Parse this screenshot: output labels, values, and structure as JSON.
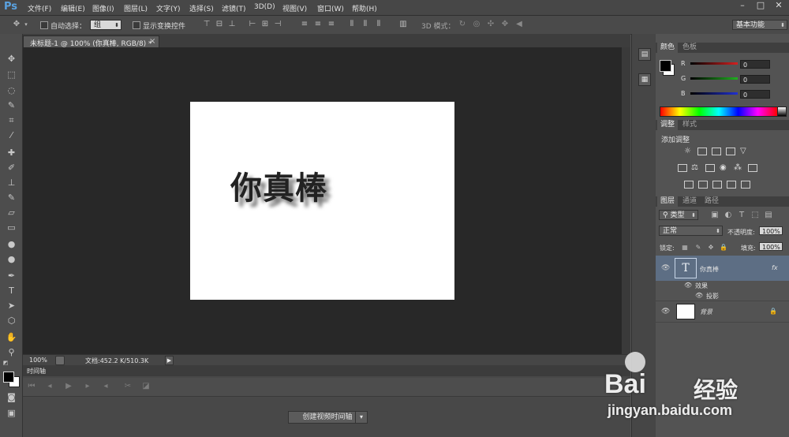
{
  "app": {
    "logo": "Ps"
  },
  "menu": [
    "文件(F)",
    "编辑(E)",
    "图像(I)",
    "图层(L)",
    "文字(Y)",
    "选择(S)",
    "滤镜(T)",
    "3D(D)",
    "视图(V)",
    "窗口(W)",
    "帮助(H)"
  ],
  "window_controls": {
    "minimize": "–",
    "restore": "□",
    "close": "✕"
  },
  "options": {
    "auto_select_label": "自动选择：",
    "auto_select_value": "组",
    "show_transform_label": "显示变换控件",
    "mode_3d_label": "3D 模式：",
    "workspace": "基本功能"
  },
  "document": {
    "tab_title": "未标题-1 @ 100% (你真棒, RGB/8) *",
    "tab_close": "×",
    "canvas_text": "你真棒",
    "zoom": "100%",
    "doc_info": "文档:452.2 K/510.3K"
  },
  "timeline": {
    "tab": "时间轴",
    "create_button": "创建视频时间轴"
  },
  "color_panel": {
    "tabs": [
      "颜色",
      "色板"
    ],
    "channels": [
      {
        "label": "R",
        "value": "0",
        "color": "#d42020"
      },
      {
        "label": "G",
        "value": "0",
        "color": "#20b020"
      },
      {
        "label": "B",
        "value": "0",
        "color": "#2030d0"
      }
    ]
  },
  "adjust_panel": {
    "tabs": [
      "调整",
      "样式"
    ],
    "title": "添加调整"
  },
  "layers_panel": {
    "tabs": [
      "图层",
      "通道",
      "路径"
    ],
    "filter_kind": "类型",
    "blend_mode": "正常",
    "opacity_label": "不透明度:",
    "opacity_value": "100%",
    "lock_label": "锁定:",
    "fill_label": "填充:",
    "fill_value": "100%",
    "layers": [
      {
        "name": "你真棒",
        "thumb": "T",
        "fx": "fx",
        "effects_label": "效果",
        "effect": "投影"
      },
      {
        "name": "背景"
      }
    ]
  },
  "watermark": {
    "brand": "Bai",
    "brand2": "经验",
    "url": "jingyan.baidu.com"
  }
}
